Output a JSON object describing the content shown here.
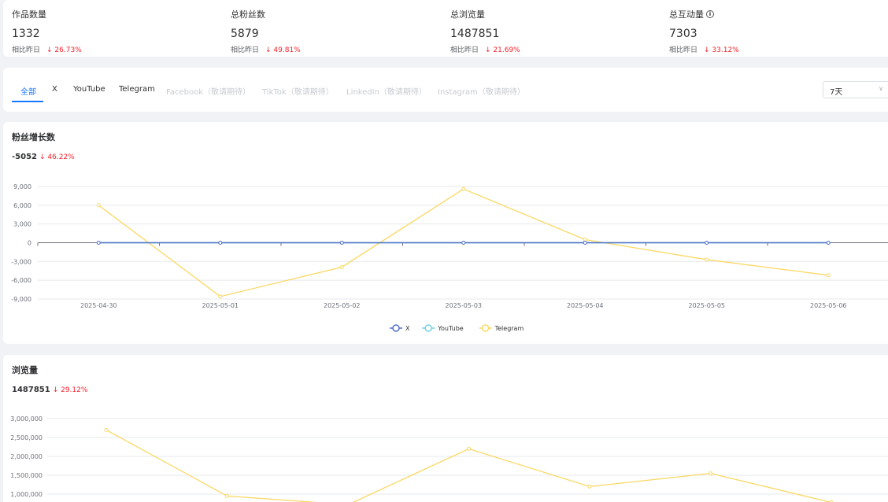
{
  "stats": [
    {
      "label": "作品数量",
      "value": "1332",
      "compare_label": "相比昨日",
      "delta": "↓ 26.73%",
      "info": false
    },
    {
      "label": "总粉丝数",
      "value": "5879",
      "compare_label": "相比昨日",
      "delta": "↓ 49.81%",
      "info": false
    },
    {
      "label": "总浏览量",
      "value": "1487851",
      "compare_label": "相比昨日",
      "delta": "↓ 21.69%",
      "info": false
    },
    {
      "label": "总互动量",
      "value": "7303",
      "compare_label": "相比昨日",
      "delta": "↓ 33.12%",
      "info": true
    }
  ],
  "tabs": [
    {
      "label": "全部",
      "state": "active"
    },
    {
      "label": "X",
      "state": "normal"
    },
    {
      "label": "YouTube",
      "state": "normal"
    },
    {
      "label": "Telegram",
      "state": "normal"
    },
    {
      "label": "Facebook（敬请期待）",
      "state": "disabled"
    },
    {
      "label": "TikTok（敬请期待）",
      "state": "disabled"
    },
    {
      "label": "LinkedIn（敬请期待）",
      "state": "disabled"
    },
    {
      "label": "Instagram（敬请期待）",
      "state": "disabled"
    }
  ],
  "range_select": {
    "value": "7天"
  },
  "fans_card": {
    "title": "粉丝增长数",
    "total": "-5052",
    "pct": "↓ 46.22%"
  },
  "views_card": {
    "title": "浏览量",
    "total": "1487851",
    "pct": "↓ 29.12%"
  },
  "colors": {
    "accent": "#1677ff",
    "down": "#f5222d",
    "x": "#5470c6",
    "youtube": "#73d1e3",
    "telegram": "#fad862"
  },
  "chart_data": [
    {
      "type": "line",
      "x": [
        "2025-04-30",
        "2025-05-01",
        "2025-05-02",
        "2025-05-03",
        "2025-05-04",
        "2025-05-05",
        "2025-05-06"
      ],
      "ylim": [
        -9000,
        9000
      ],
      "yticks": [
        "9,000",
        "6,000",
        "3,000",
        "0",
        "-3,000",
        "-6,000",
        "-9,000"
      ],
      "series": [
        {
          "name": "X",
          "values": [
            0,
            0,
            0,
            0,
            0,
            0,
            0
          ]
        },
        {
          "name": "YouTube",
          "values": [
            0,
            0,
            0,
            0,
            0,
            0,
            0
          ]
        },
        {
          "name": "Telegram",
          "values": [
            6000,
            -8600,
            -3900,
            8600,
            500,
            -2700,
            -5200
          ]
        }
      ],
      "legend": "bottom-center",
      "grid": true
    },
    {
      "type": "line",
      "ylim": [
        0,
        3000000
      ],
      "yticks": [
        "3,000,000",
        "2,500,000",
        "2,000,000",
        "1,500,000",
        "1,000,000"
      ],
      "series": [
        {
          "name": "Telegram",
          "values": [
            2700000,
            950000,
            720000,
            2200000,
            1200000,
            1550000,
            780000
          ]
        }
      ],
      "grid": true
    }
  ]
}
